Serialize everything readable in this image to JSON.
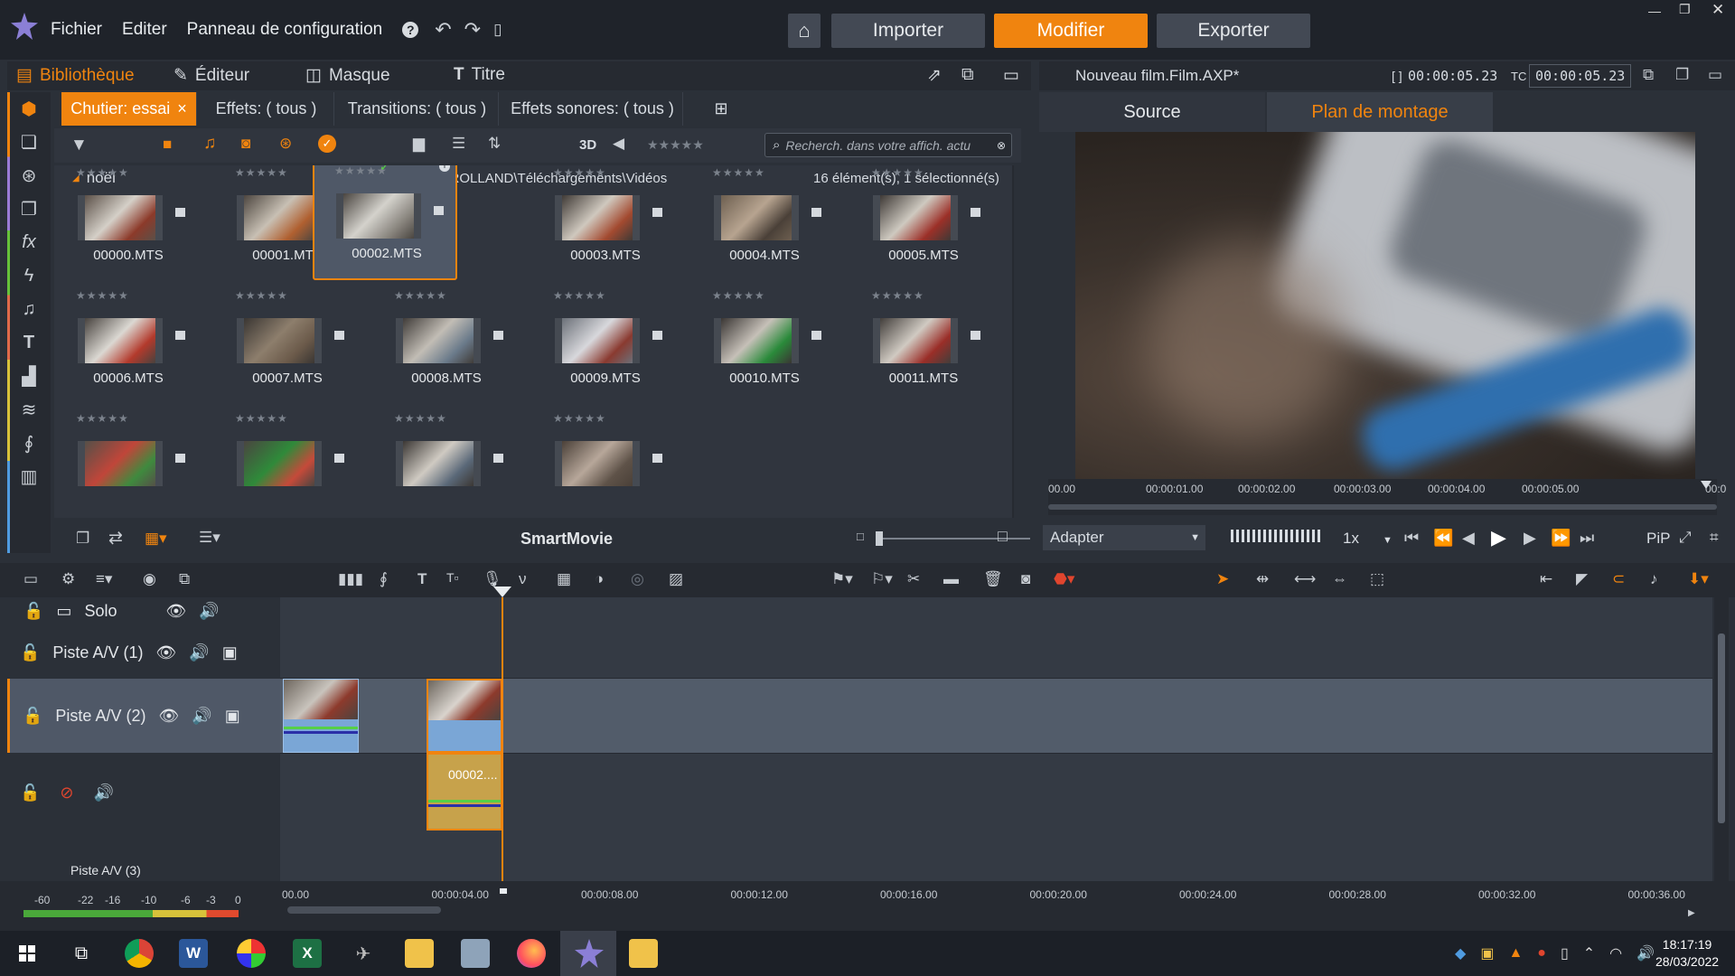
{
  "menu": {
    "file": "Fichier",
    "edit": "Editer",
    "control_panel": "Panneau de configuration"
  },
  "modes": {
    "import": "Importer",
    "edit": "Modifier",
    "export": "Exporter",
    "active": "Modifier"
  },
  "library_tabs": {
    "library": "Bibliothèque",
    "editor": "Éditeur",
    "mask": "Masque",
    "title": "Titre"
  },
  "subtabs": {
    "bin": "Chutier: essai",
    "effects": "Effets: ( tous )",
    "transitions": "Transitions: ( tous )",
    "sound_effects": "Effets sonores: ( tous )"
  },
  "toolbar": {
    "three_d": "3D",
    "search_placeholder": "Recherch. dans votre affich. actu"
  },
  "folder": {
    "name": "noël",
    "path": "C:\\Utilisateurs\\ROLLAND\\Téléchargements\\Vidéos",
    "count": "16 élément(s), 1 sélectionné(s)"
  },
  "thumbnails": [
    {
      "name": "00000.MTS"
    },
    {
      "name": "00001.MTS"
    },
    {
      "name": "00002.MTS"
    },
    {
      "name": "00003.MTS"
    },
    {
      "name": "00004.MTS"
    },
    {
      "name": "00005.MTS"
    },
    {
      "name": "00006.MTS"
    },
    {
      "name": "00007.MTS"
    },
    {
      "name": "00008.MTS"
    },
    {
      "name": "00009.MTS"
    },
    {
      "name": "00010.MTS"
    },
    {
      "name": "00011.MTS"
    },
    {
      "name": ""
    },
    {
      "name": ""
    },
    {
      "name": ""
    },
    {
      "name": ""
    }
  ],
  "stars": "★★★★★",
  "library_bottom": {
    "smartmovie": "SmartMovie"
  },
  "preview": {
    "title": "Nouveau film.Film.AXP*",
    "bracket": "[ ]",
    "duration": "00:00:05.23",
    "tc_label": "TC",
    "timecode": "00:00:05.23",
    "tab_source": "Source",
    "tab_timeline": "Plan de montage"
  },
  "preview_ruler": [
    "00.00",
    "00:00:01.00",
    "00:00:02.00",
    "00:00:03.00",
    "00:00:04.00",
    "00:00:05.00",
    "00:0"
  ],
  "transport": {
    "fit": "Adapter",
    "speed": "1x",
    "pip": "PiP"
  },
  "tracks": {
    "solo": "Solo",
    "track1": "Piste A/V (1)",
    "track2": "Piste A/V (2)",
    "track3": "Piste A/V (3)",
    "clip_label": "00002...."
  },
  "meter_labels": [
    "-60",
    "-22",
    "-16",
    "-10",
    "-6",
    "-3",
    "0"
  ],
  "timeline_ruler": [
    "00.00",
    "00:00:04.00",
    "00:00:08.00",
    "00:00:12.00",
    "00:00:16.00",
    "00:00:20.00",
    "00:00:24.00",
    "00:00:28.00",
    "00:00:32.00",
    "00:00:36.00"
  ],
  "clock": {
    "time": "18:17:19",
    "date": "28/03/2022"
  },
  "colors": {
    "accent": "#f0840f",
    "panel": "#30353e"
  }
}
